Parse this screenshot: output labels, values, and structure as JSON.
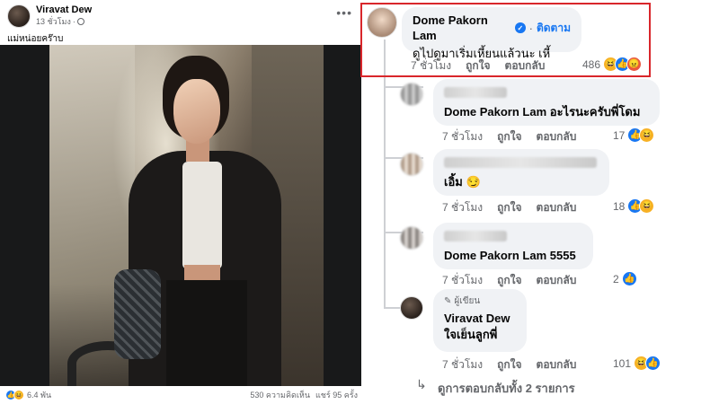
{
  "post": {
    "author": "Viravat Dew",
    "time": "13 ชั่วโมง",
    "caption": "แม่หน่อยคร๊าบ",
    "reaction_count": "6.4 พัน",
    "comment_count": "530 ความคิดเห็น",
    "share_count": "แชร์ 95 ครั้ง"
  },
  "comments": [
    {
      "author": "Dome Pakorn Lam",
      "verified": true,
      "follow_label": "ติดตาม",
      "text": "ดูไปดูมาเริ่มเหี้ยนแล้วนะ เหี้",
      "time": "7 ชั่วโมง",
      "like_label": "ถูกใจ",
      "reply_label": "ตอบกลับ",
      "reactions": "486"
    },
    {
      "text": "Dome Pakorn Lam อะไรนะครับพี่โดม",
      "time": "7 ชั่วโมง",
      "like_label": "ถูกใจ",
      "reply_label": "ตอบกลับ",
      "reactions": "17"
    },
    {
      "text": "เอิ้ม",
      "time": "7 ชั่วโมง",
      "like_label": "ถูกใจ",
      "reply_label": "ตอบกลับ",
      "reactions": "18"
    },
    {
      "text": "Dome Pakorn Lam 5555",
      "time": "7 ชั่วโมง",
      "like_label": "ถูกใจ",
      "reply_label": "ตอบกลับ",
      "reactions": "2"
    },
    {
      "author_badge": "ผู้เขียน",
      "author": "Viravat Dew",
      "text": "ใจเย็นลูกพี่",
      "time": "7 ชั่วโมง",
      "like_label": "ถูกใจ",
      "reply_label": "ตอบกลับ",
      "reactions": "101"
    }
  ],
  "view_replies": "ดูการตอบกลับทั้ง 2 รายการ",
  "colors": {
    "accent": "#1877f2",
    "highlight": "#d9262b",
    "bubble": "#f0f2f5",
    "muted_text": "#65676b"
  }
}
